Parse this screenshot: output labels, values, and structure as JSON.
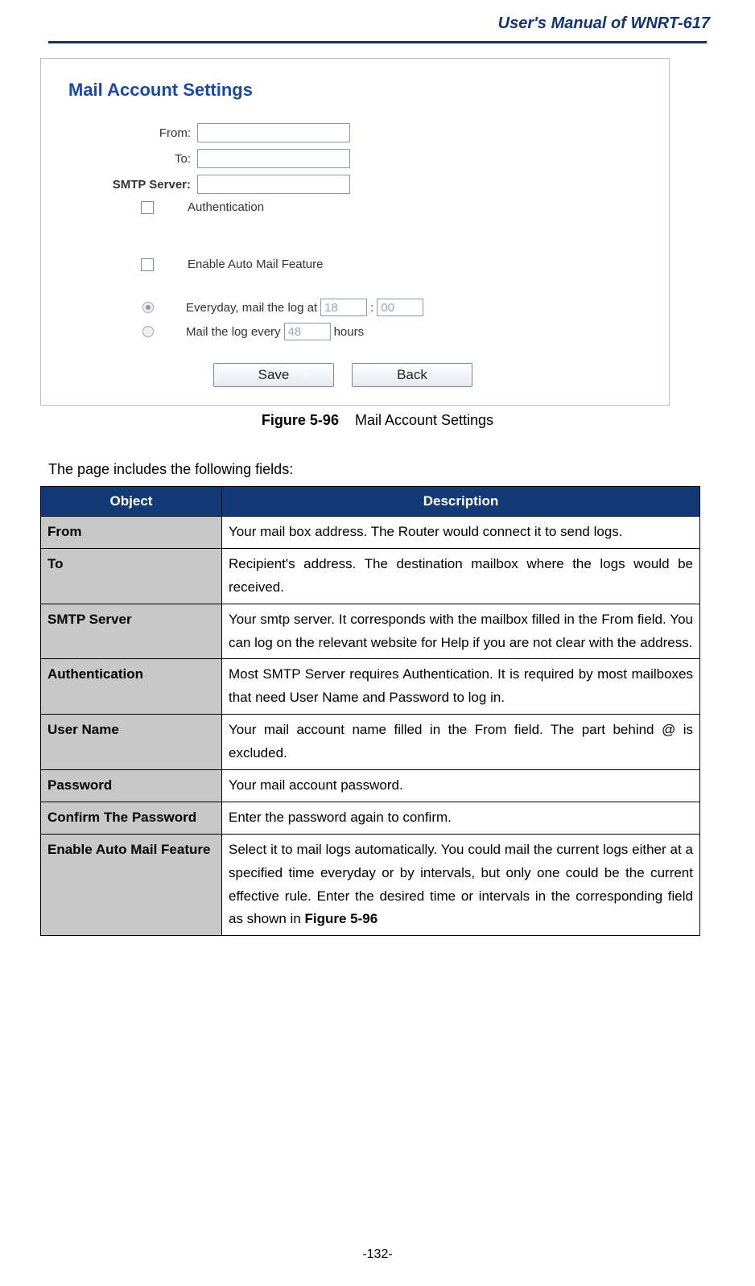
{
  "header": {
    "title": "User's  Manual  of  WNRT-617"
  },
  "figure": {
    "section_title": "Mail Account Settings",
    "labels": {
      "from": "From:",
      "to": "To:",
      "smtp": "SMTP Server:",
      "auth": "Authentication",
      "enable_auto": "Enable Auto Mail Feature",
      "everyday_prefix": "Everyday, mail the log at",
      "time_sep": ":",
      "interval_prefix": "Mail the log every",
      "interval_suffix": "hours"
    },
    "values": {
      "hour": "18",
      "minute": "00",
      "interval": "48"
    },
    "buttons": {
      "save": "Save",
      "back": "Back"
    },
    "caption_num": "Figure 5-96",
    "caption_text": "Mail Account Settings"
  },
  "intro": "The page includes the following fields:",
  "table": {
    "headers": {
      "object": "Object",
      "description": "Description"
    },
    "rows": [
      {
        "obj": "From",
        "desc": "Your mail box address. The Router would connect it to send logs."
      },
      {
        "obj": "To",
        "desc": "Recipient's address. The destination mailbox where the logs would be received."
      },
      {
        "obj": "SMTP Server",
        "desc": "Your smtp server. It corresponds with the mailbox filled in the From field. You can log on the relevant website for Help if you are not clear with the address."
      },
      {
        "obj": "Authentication",
        "desc": "Most SMTP Server requires Authentication. It is required by most mailboxes that need User Name and Password to log in."
      },
      {
        "obj": "User Name",
        "desc": "Your mail account name filled in the From field. The part behind @ is excluded."
      },
      {
        "obj": "Password",
        "desc": "Your mail account password."
      },
      {
        "obj": "Confirm The Password",
        "desc": "Enter the password again to confirm."
      },
      {
        "obj": "Enable Auto Mail Feature",
        "desc_prefix": "Select it to mail logs automatically. You could mail the current logs either at a specified time everyday or by intervals, but only one could be the current effective rule. Enter the desired time or intervals in the corresponding field as shown in ",
        "desc_bold": "Figure 5-96"
      }
    ]
  },
  "page_number": "-132-"
}
